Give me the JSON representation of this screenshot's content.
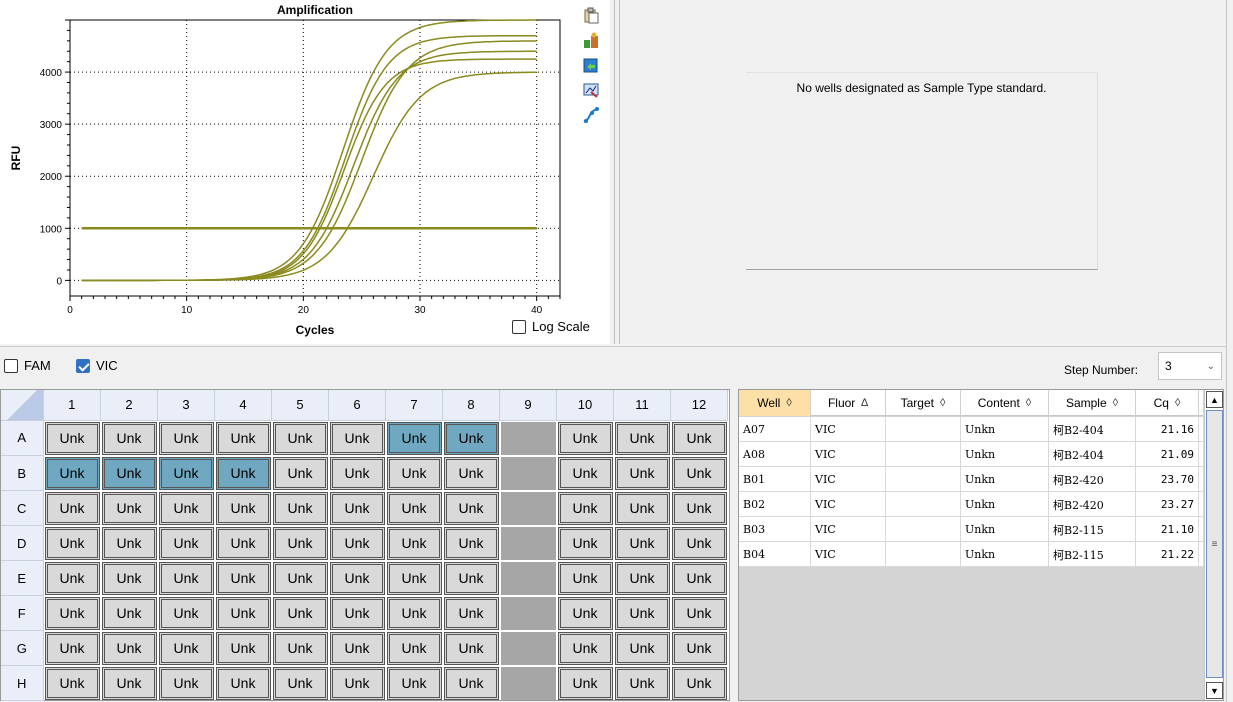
{
  "chart": {
    "log_scale_label": "Log Scale",
    "log_scale_checked": false,
    "tools": [
      "copy-icon",
      "export-icon",
      "refresh-icon",
      "zoom-icon",
      "curve-icon"
    ]
  },
  "chart_data": {
    "type": "line",
    "title": "Amplification",
    "xlabel": "Cycles",
    "ylabel": "RFU",
    "xlim": [
      0,
      42
    ],
    "ylim": [
      -300,
      5000
    ],
    "x_ticks": [
      0,
      10,
      20,
      30,
      40
    ],
    "y_ticks": [
      0,
      1000,
      2000,
      3000,
      4000
    ],
    "grid": true,
    "color": "#8a8a1e",
    "threshold": 1000,
    "x_range": [
      1,
      40
    ],
    "series": [
      {
        "midpoint": 23.5,
        "plateau": 4250,
        "slope": 0.3
      },
      {
        "midpoint": 23.6,
        "plateau": 4700,
        "slope": 0.29
      },
      {
        "midpoint": 25.0,
        "plateau": 4600,
        "slope": 0.27
      },
      {
        "midpoint": 24.3,
        "plateau": 4400,
        "slope": 0.28
      },
      {
        "midpoint": 26.0,
        "plateau": 4000,
        "slope": 0.26
      },
      {
        "midpoint": 23.4,
        "plateau": 5000,
        "slope": 0.28
      }
    ]
  },
  "standard_curve": {
    "message": "No wells designated as Sample Type standard."
  },
  "fluors": [
    {
      "label": "FAM",
      "checked": false
    },
    {
      "label": "VIC",
      "checked": true
    }
  ],
  "step": {
    "label": "Step Number:",
    "value": "3"
  },
  "plate": {
    "columns": [
      "1",
      "2",
      "3",
      "4",
      "5",
      "6",
      "7",
      "8",
      "9",
      "10",
      "11",
      "12"
    ],
    "rows": [
      "A",
      "B",
      "C",
      "D",
      "E",
      "F",
      "G",
      "H"
    ],
    "well_label": "Unk",
    "empty_column": "9",
    "selected": [
      "A7",
      "A8",
      "B1",
      "B2",
      "B3",
      "B4"
    ]
  },
  "results": {
    "columns": [
      {
        "label": "Well",
        "sort": "◊",
        "active": true
      },
      {
        "label": "Fluor",
        "sort": "∆",
        "active": false
      },
      {
        "label": "Target",
        "sort": "◊",
        "active": false
      },
      {
        "label": "Content",
        "sort": "◊",
        "active": false
      },
      {
        "label": "Sample",
        "sort": "◊",
        "active": false
      },
      {
        "label": "Cq",
        "sort": "◊",
        "active": false
      }
    ],
    "rows": [
      [
        "A07",
        "VIC",
        "",
        "Unkn",
        "柯B2-404",
        "21.16"
      ],
      [
        "A08",
        "VIC",
        "",
        "Unkn",
        "柯B2-404",
        "21.09"
      ],
      [
        "B01",
        "VIC",
        "",
        "Unkn",
        "柯B2-420",
        "23.70"
      ],
      [
        "B02",
        "VIC",
        "",
        "Unkn",
        "柯B2-420",
        "23.27"
      ],
      [
        "B03",
        "VIC",
        "",
        "Unkn",
        "柯B2-115",
        "21.10"
      ],
      [
        "B04",
        "VIC",
        "",
        "Unkn",
        "柯B2-115",
        "21.22"
      ]
    ]
  }
}
